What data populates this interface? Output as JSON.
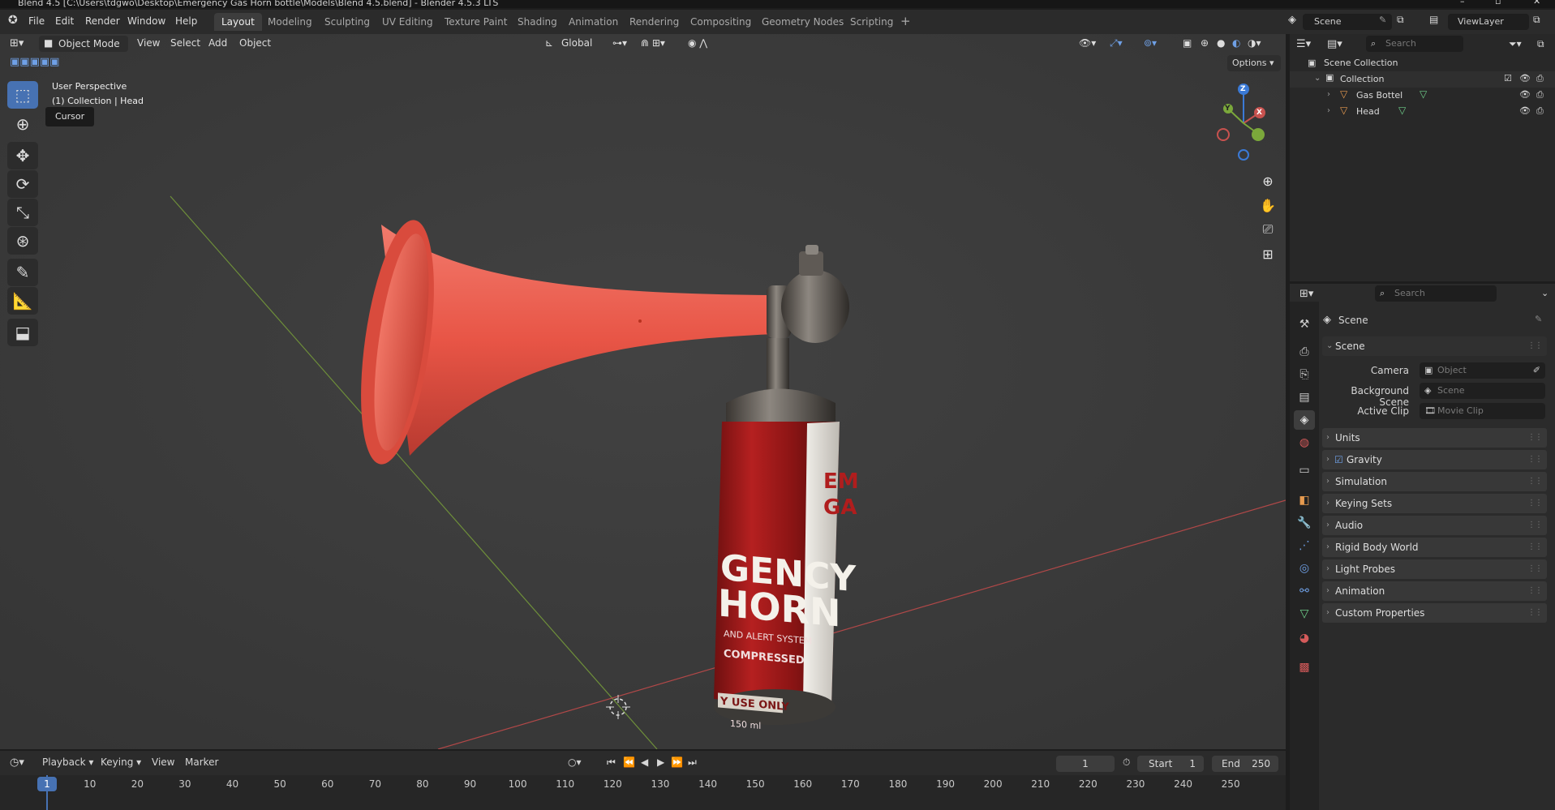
{
  "titlebar": {
    "text": "Blend 4.5 [C:\\Users\\tdgwo\\Desktop\\Emergency Gas Horn bottle\\Models\\Blend 4.5.blend] - Blender 4.5.3 LTS"
  },
  "menus": [
    "File",
    "Edit",
    "Render",
    "Window",
    "Help"
  ],
  "workspaces": [
    "Layout",
    "Modeling",
    "Sculpting",
    "UV Editing",
    "Texture Paint",
    "Shading",
    "Animation",
    "Rendering",
    "Compositing",
    "Geometry Nodes",
    "Scripting"
  ],
  "active_workspace": "Layout",
  "scene_selector": "Scene",
  "viewlayer_selector": "ViewLayer",
  "viewport": {
    "mode": "Object Mode",
    "menu": [
      "View",
      "Select",
      "Add",
      "Object"
    ],
    "orientation": "Global",
    "options": "Options",
    "overlay_title": "User Perspective",
    "overlay_subtitle": "(1) Collection | Head",
    "tooltip": "Cursor",
    "gizmo": {
      "x": "X",
      "y": "Y",
      "z": "Z"
    },
    "model_text": {
      "line1": "GENCY",
      "line2": "HORN",
      "line3": "AND ALERT SYSTEM",
      "line4": "COMPRESSED",
      "line5": "Y USE ONLY",
      "line6": "150 ml",
      "side1": "EM",
      "side2": "GA"
    }
  },
  "outliner": {
    "search_placeholder": "Search",
    "root": "Scene Collection",
    "collection": "Collection",
    "items": [
      "Gas Bottel",
      "Head"
    ]
  },
  "properties": {
    "search_placeholder": "Search",
    "context": "Scene",
    "section": "Scene",
    "fields": [
      {
        "label": "Camera",
        "placeholder": "Object"
      },
      {
        "label": "Background Scene",
        "placeholder": "Scene"
      },
      {
        "label": "Active Clip",
        "placeholder": "Movie Clip"
      }
    ],
    "panels": [
      "Units",
      "Gravity",
      "Simulation",
      "Keying Sets",
      "Audio",
      "Rigid Body World",
      "Light Probes",
      "Animation",
      "Custom Properties"
    ],
    "gravity_checked": true
  },
  "timeline": {
    "menus": [
      "Playback",
      "Keying",
      "View",
      "Marker"
    ],
    "current_frame": "1",
    "start_label": "Start",
    "start": "1",
    "end_label": "End",
    "end": "250",
    "ticks": [
      "1",
      "10",
      "20",
      "30",
      "40",
      "50",
      "60",
      "70",
      "80",
      "90",
      "100",
      "110",
      "120",
      "130",
      "140",
      "150",
      "160",
      "170",
      "180",
      "190",
      "200",
      "210",
      "220",
      "230",
      "240",
      "250"
    ]
  },
  "colors": {
    "accent": "#4772b3",
    "x_axis": "#c8524f",
    "y_axis": "#7ba83b",
    "z_axis": "#3b7ad6",
    "horn": "#e8564a"
  }
}
